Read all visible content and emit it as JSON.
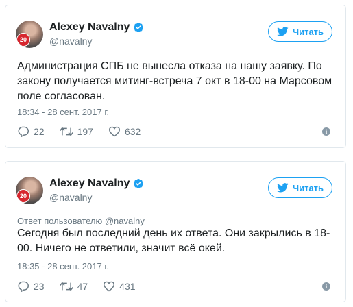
{
  "tweets": [
    {
      "author": "Alexey Navalny",
      "handle": "@navalny",
      "badge": "20",
      "follow_label": "Читать",
      "reply_to": "",
      "text": "Администрация СПБ не вынесла отказа на нашу заявку. По закону получается митинг-встреча 7 окт в 18-00 на Марсовом поле согласован.",
      "timestamp": "18:34 - 28 сент. 2017 г.",
      "replies": "22",
      "retweets": "197",
      "likes": "632"
    },
    {
      "author": "Alexey Navalny",
      "handle": "@navalny",
      "badge": "20",
      "follow_label": "Читать",
      "reply_to": "Ответ пользователю @navalny",
      "text": "Сегодня был последний день их ответа. Они закрылись в 18-00. Ничего не ответили, значит всё окей.",
      "timestamp": "18:35 - 28 сент. 2017 г.",
      "replies": "23",
      "retweets": "47",
      "likes": "431"
    }
  ],
  "colors": {
    "accent": "#1da1f2",
    "muted": "#697882",
    "border": "#e1e8ed",
    "badge": "#d7262e"
  },
  "icons": [
    "verified-icon",
    "twitter-bird-icon",
    "reply-icon",
    "retweet-icon",
    "like-icon",
    "info-icon"
  ]
}
